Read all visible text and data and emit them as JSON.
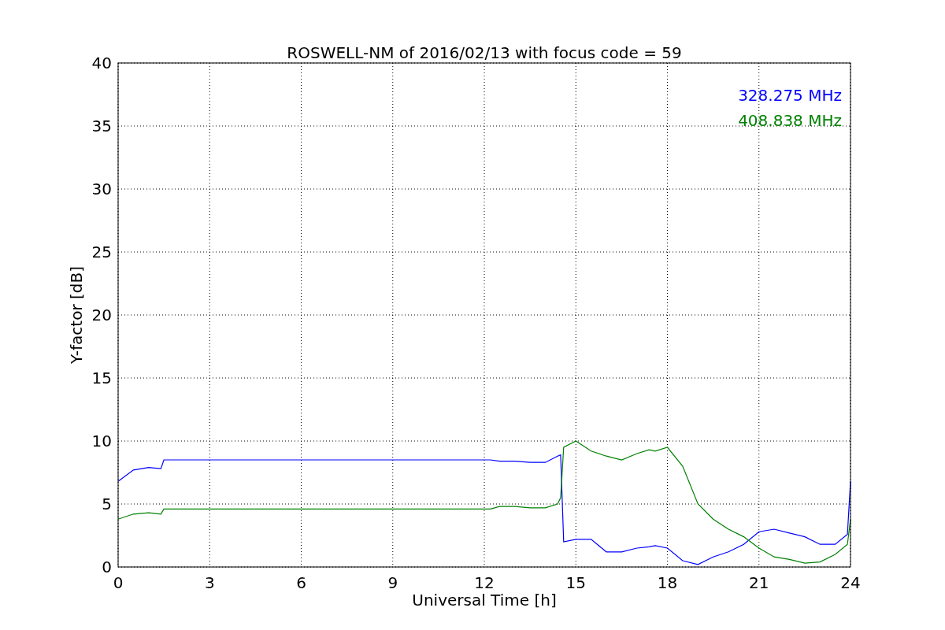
{
  "chart_data": {
    "type": "line",
    "title": "ROSWELL-NM of 2016/02/13 with focus code = 59",
    "xlabel": "Universal Time [h]",
    "ylabel": "Y-factor [dB]",
    "x": [
      0,
      0.5,
      1,
      1.4,
      1.5,
      12.2,
      12.5,
      13,
      13.5,
      14,
      14.4,
      14.5,
      14.6,
      15,
      15.5,
      16,
      16.5,
      17,
      17.4,
      17.6,
      18,
      18.5,
      19,
      19.5,
      20,
      20.5,
      21,
      21.5,
      22,
      22.5,
      23,
      23.5,
      23.9,
      24
    ],
    "series": [
      {
        "name": "328.275 MHz",
        "color": "#0000ff",
        "values": [
          6.8,
          7.7,
          7.9,
          7.8,
          8.5,
          8.5,
          8.4,
          8.4,
          8.3,
          8.3,
          8.8,
          8.9,
          2,
          2.2,
          2.2,
          1.2,
          1.2,
          1.5,
          1.6,
          1.7,
          1.5,
          0.5,
          0.2,
          0.8,
          1.2,
          1.8,
          2.8,
          3,
          2.7,
          2.4,
          1.8,
          1.8,
          2.6,
          6.8
        ]
      },
      {
        "name": "408.838 MHz",
        "color": "#008000",
        "values": [
          3.8,
          4.2,
          4.3,
          4.2,
          4.6,
          4.6,
          4.8,
          4.8,
          4.7,
          4.7,
          5,
          5.5,
          9.5,
          10,
          9.2,
          8.8,
          8.5,
          9,
          9.3,
          9.2,
          9.5,
          8,
          5,
          3.8,
          3,
          2.4,
          1.5,
          0.8,
          0.6,
          0.3,
          0.4,
          1,
          1.8,
          3.8
        ]
      }
    ],
    "xlim": [
      0,
      24
    ],
    "ylim": [
      0,
      40
    ],
    "xticks": [
      0,
      3,
      6,
      9,
      12,
      15,
      18,
      21,
      24
    ],
    "yticks": [
      0,
      5,
      10,
      15,
      20,
      25,
      30,
      35,
      40
    ],
    "grid": true
  }
}
